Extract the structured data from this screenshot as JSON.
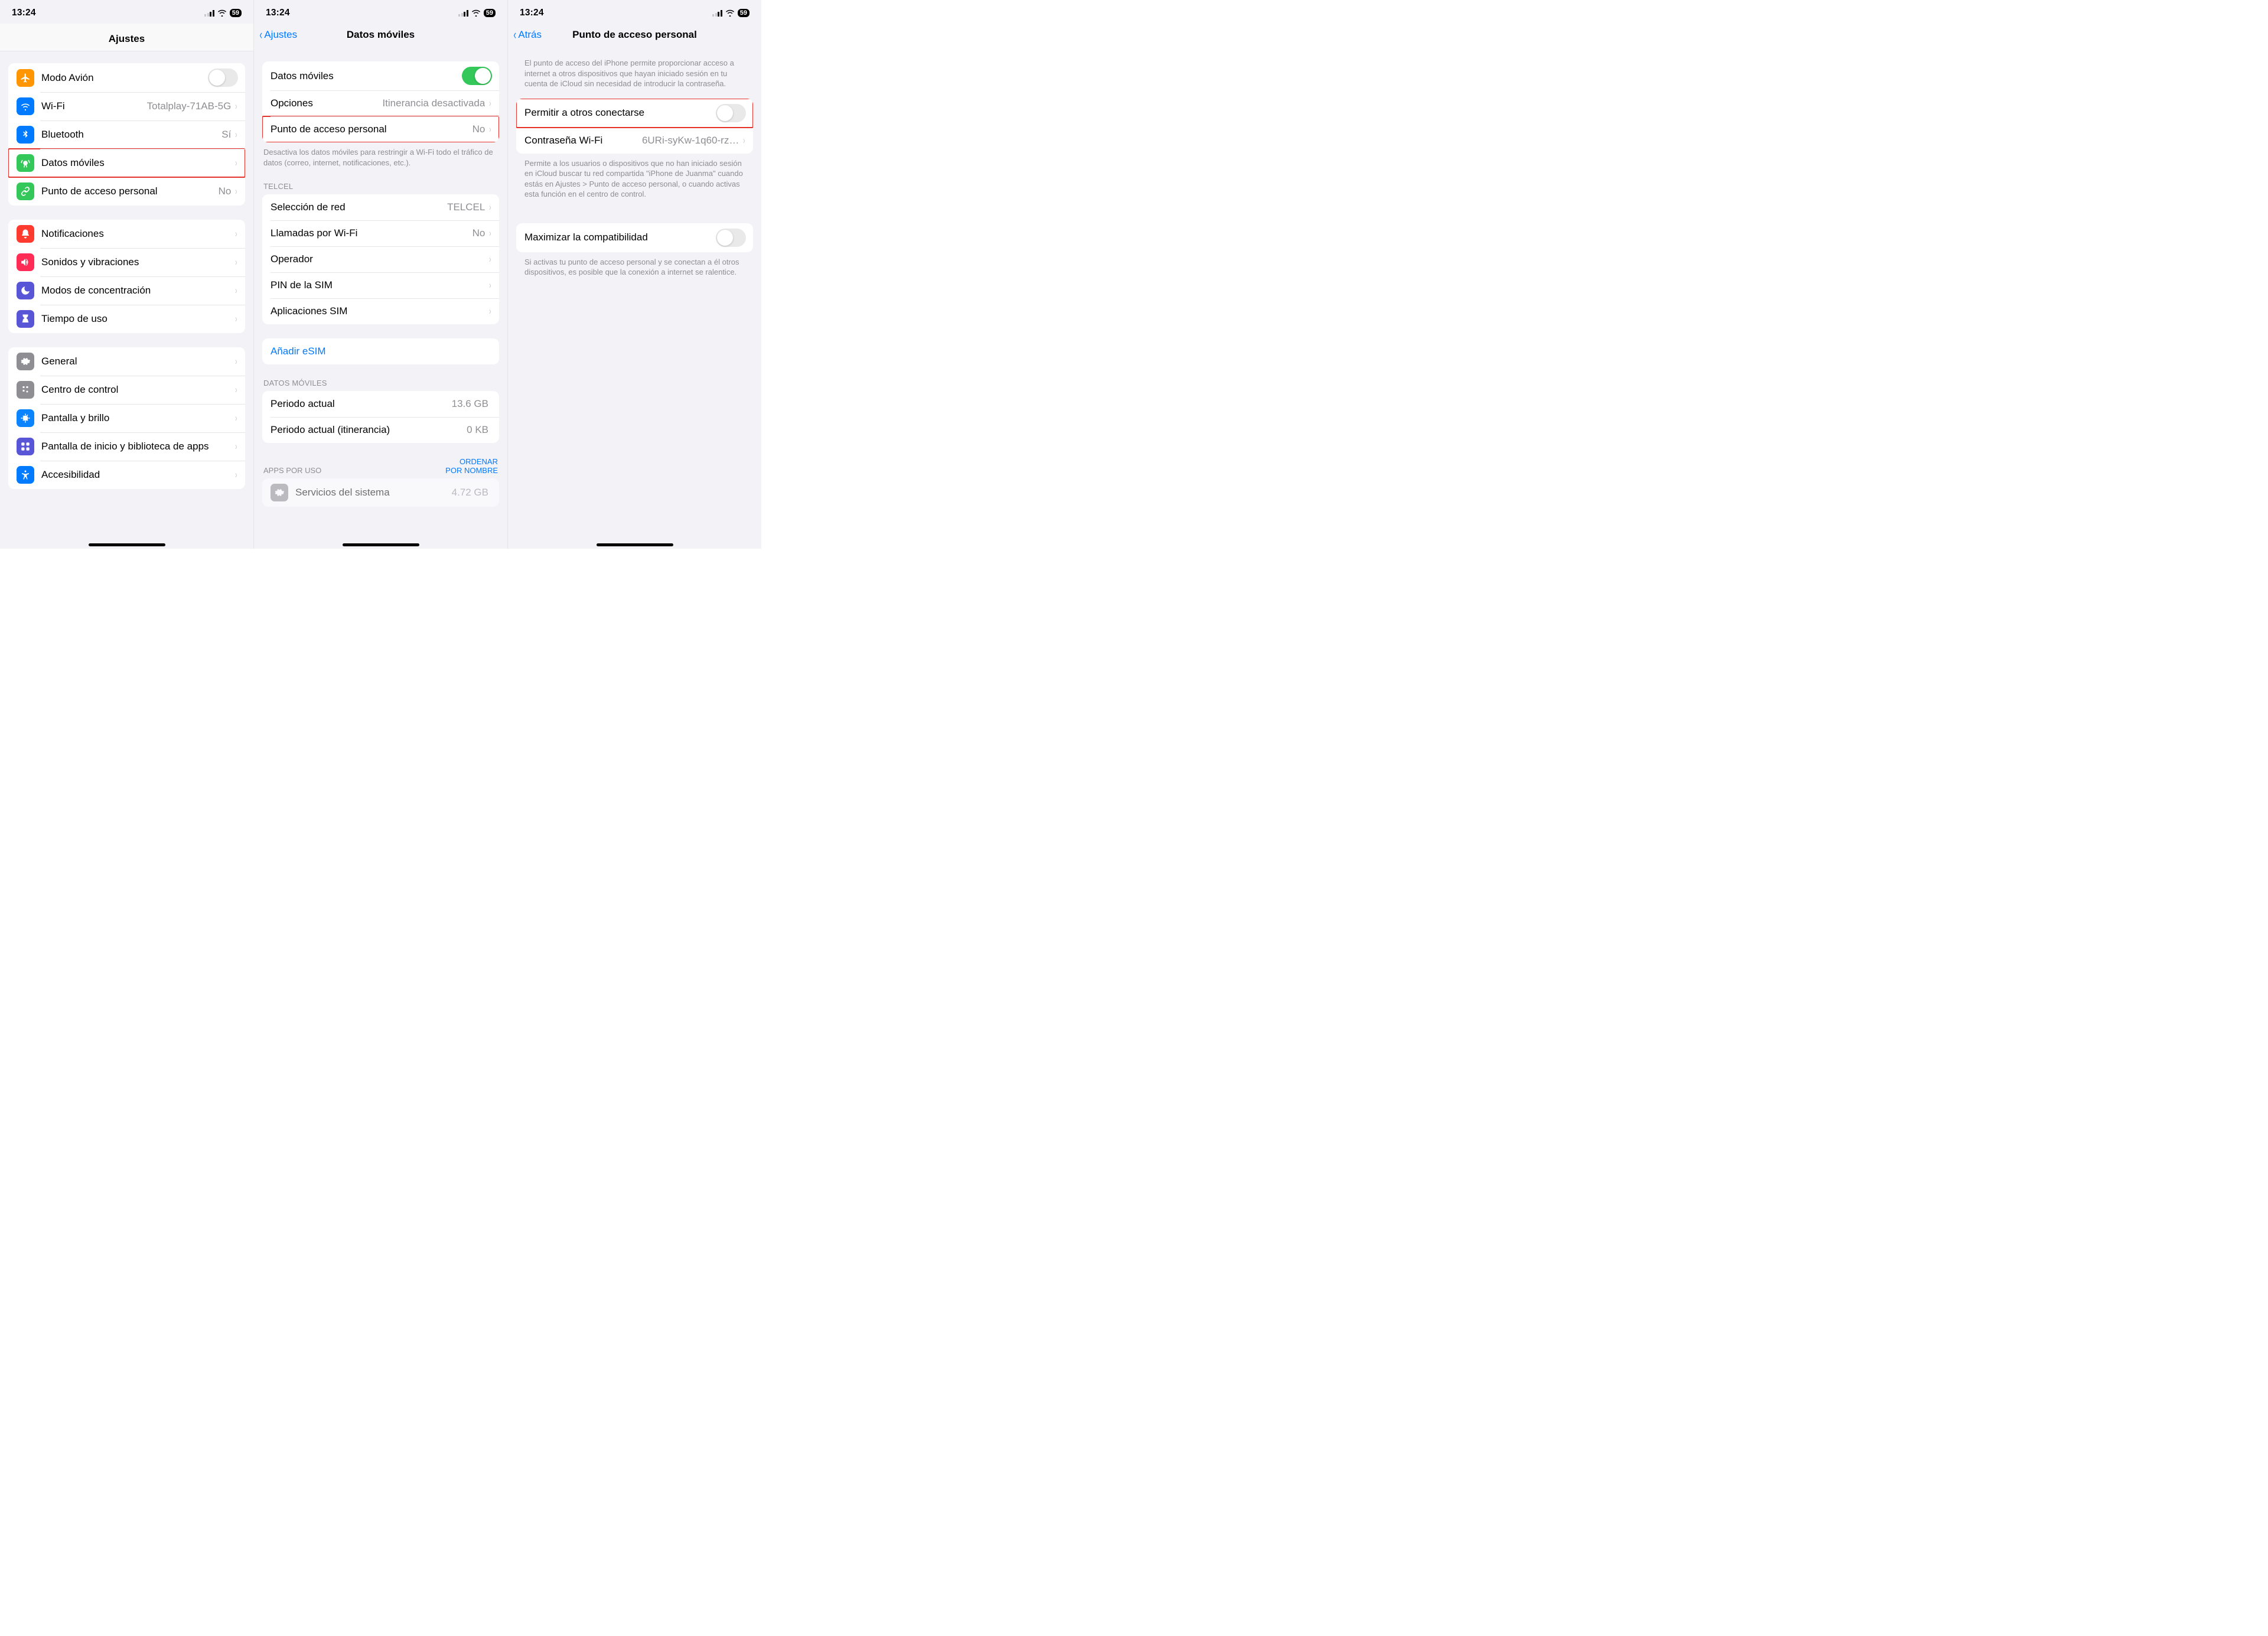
{
  "status": {
    "time": "13:24",
    "battery": "59"
  },
  "screen1": {
    "title": "Ajustes",
    "group1": [
      {
        "label": "Modo Avión",
        "icon": "airplane",
        "color": "#ff9500",
        "toggle": false
      },
      {
        "label": "Wi-Fi",
        "icon": "wifi",
        "color": "#007aff",
        "value": "Totalplay-71AB-5G"
      },
      {
        "label": "Bluetooth",
        "icon": "bluetooth",
        "color": "#007aff",
        "value": "Sí"
      },
      {
        "label": "Datos móviles",
        "icon": "antenna",
        "color": "#34c759",
        "highlight": true
      },
      {
        "label": "Punto de acceso personal",
        "icon": "link",
        "color": "#34c759",
        "value": "No"
      }
    ],
    "group2": [
      {
        "label": "Notificaciones",
        "icon": "bell",
        "color": "#ff3b30"
      },
      {
        "label": "Sonidos y vibraciones",
        "icon": "sound",
        "color": "#ff2d55"
      },
      {
        "label": "Modos de concentración",
        "icon": "moon",
        "color": "#5856d6"
      },
      {
        "label": "Tiempo de uso",
        "icon": "hourglass",
        "color": "#5856d6"
      }
    ],
    "group3": [
      {
        "label": "General",
        "icon": "gear",
        "color": "#8e8e93"
      },
      {
        "label": "Centro de control",
        "icon": "control",
        "color": "#8e8e93"
      },
      {
        "label": "Pantalla y brillo",
        "icon": "brightness",
        "color": "#0a84ff"
      },
      {
        "label": "Pantalla de inicio y biblioteca de apps",
        "icon": "grid",
        "color": "#5856d6"
      },
      {
        "label": "Accesibilidad",
        "icon": "accessibility",
        "color": "#007aff"
      }
    ]
  },
  "screen2": {
    "back": "Ajustes",
    "title": "Datos móviles",
    "group1": {
      "items": [
        {
          "label": "Datos móviles",
          "toggle": true
        },
        {
          "label": "Opciones",
          "value": "Itinerancia desactivada"
        },
        {
          "label": "Punto de acceso personal",
          "value": "No",
          "highlight": true
        }
      ],
      "footer": "Desactiva los datos móviles para restringir a Wi-Fi todo el tráfico de datos (correo, internet, notificaciones, etc.)."
    },
    "carrier": "TELCEL",
    "group2": [
      {
        "label": "Selección de red",
        "value": "TELCEL"
      },
      {
        "label": "Llamadas por Wi-Fi",
        "value": "No"
      },
      {
        "label": "Operador"
      },
      {
        "label": "PIN de la SIM"
      },
      {
        "label": "Aplicaciones SIM"
      }
    ],
    "esim": "Añadir eSIM",
    "dataHeader": "DATOS MÓVILES",
    "group3": [
      {
        "label": "Periodo actual",
        "value": "13.6 GB"
      },
      {
        "label": "Periodo actual (itinerancia)",
        "value": "0 KB"
      }
    ],
    "appsHeader": "APPS POR USO",
    "sortLink": "ORDENAR\nPOR NOMBRE",
    "group4": [
      {
        "label": "Servicios del sistema",
        "value": "4.72 GB"
      }
    ]
  },
  "screen3": {
    "back": "Atrás",
    "title": "Punto de acceso personal",
    "intro": "El punto de acceso del iPhone permite proporcionar acceso a internet a otros dispositivos que hayan iniciado sesión en tu cuenta de iCloud sin necesidad de introducir la contraseña.",
    "group1": {
      "items": [
        {
          "label": "Permitir a otros conectarse",
          "toggle": false,
          "highlight": true
        },
        {
          "label": "Contraseña Wi-Fi",
          "value": "6URi-syKw-1q60-rz…"
        }
      ],
      "footer": "Permite a los usuarios o dispositivos que no han iniciado sesión en iCloud buscar tu red compartida \"iPhone de Juanma\" cuando estás en Ajustes > Punto de acceso personal, o cuando activas esta función en el centro de control."
    },
    "group2": {
      "items": [
        {
          "label": "Maximizar la compatibilidad",
          "toggle": false
        }
      ],
      "footer": "Si activas tu punto de acceso personal y se conectan a él otros dispositivos, es posible que la conexión a internet se ralentice."
    }
  }
}
